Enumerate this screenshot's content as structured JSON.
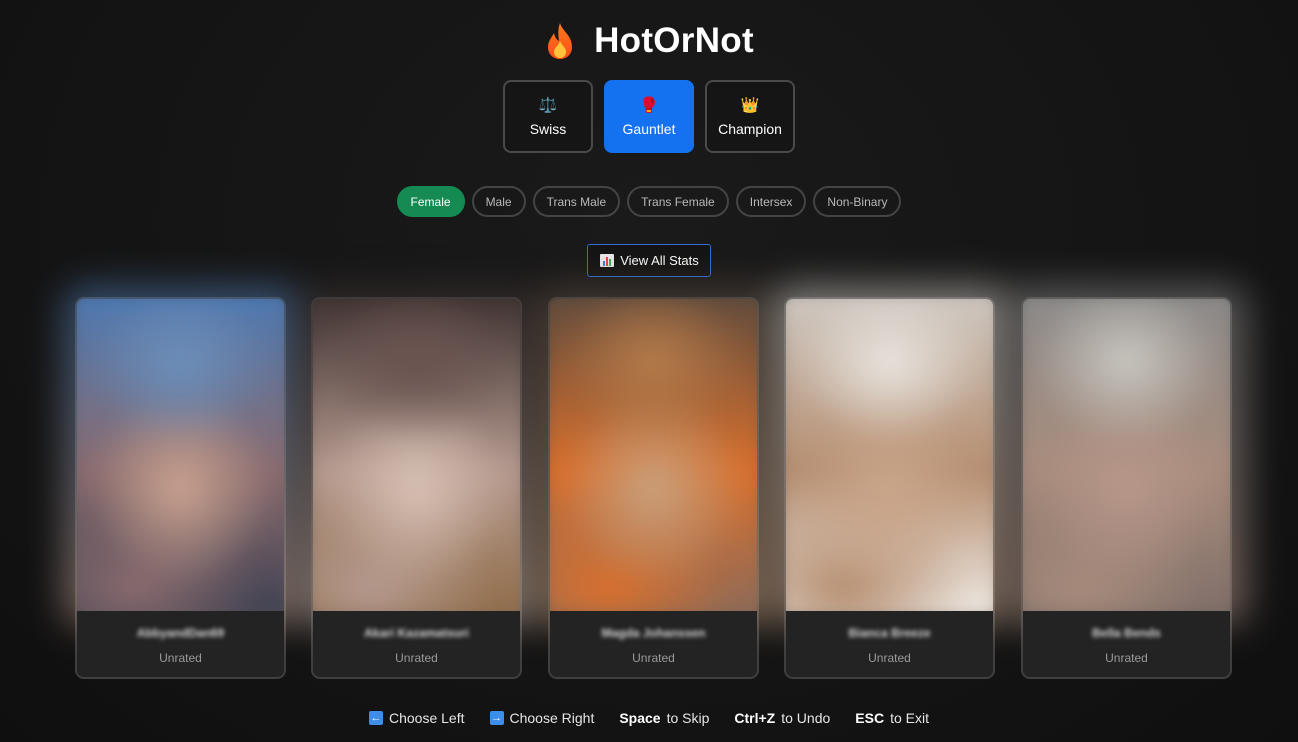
{
  "app": {
    "title": "HotOrNot",
    "logo_icon": "flame-icon"
  },
  "modes": [
    {
      "label": "Swiss",
      "icon": "⚖️",
      "icon_name": "scales-icon",
      "active": false
    },
    {
      "label": "Gauntlet",
      "icon": "🥊",
      "icon_name": "boxing-glove-icon",
      "active": true
    },
    {
      "label": "Champion",
      "icon": "👑",
      "icon_name": "crown-icon",
      "active": false
    }
  ],
  "genders": [
    {
      "label": "Female",
      "active": true
    },
    {
      "label": "Male",
      "active": false
    },
    {
      "label": "Trans Male",
      "active": false
    },
    {
      "label": "Trans Female",
      "active": false
    },
    {
      "label": "Intersex",
      "active": false
    },
    {
      "label": "Non-Binary",
      "active": false
    }
  ],
  "stats_button": {
    "label": "View All Stats",
    "icon": "bar-chart-icon"
  },
  "cards": [
    {
      "name": "AbbyandDan69",
      "rating": "Unrated",
      "tones": [
        "#4a79b4",
        "#6c8fba",
        "#8a6b6e",
        "#c9a28f",
        "#3b3f50"
      ]
    },
    {
      "name": "Akari Kazamatsuri",
      "rating": "Unrated",
      "tones": [
        "#3a2e2e",
        "#6b5450",
        "#b59a8f",
        "#d7c0b4",
        "#8e6a45"
      ]
    },
    {
      "name": "Magda Johanssen",
      "rating": "Unrated",
      "tones": [
        "#5c4a3d",
        "#b47b4a",
        "#d9702d",
        "#c9a07c",
        "#8a6a5a"
      ]
    },
    {
      "name": "Bianca Breeze",
      "rating": "Unrated",
      "tones": [
        "#cfcac4",
        "#e8e4de",
        "#b58d6f",
        "#c9a58a",
        "#f0ede8"
      ]
    },
    {
      "name": "Bella Bends",
      "rating": "Unrated",
      "tones": [
        "#8a8a8a",
        "#c9c6c0",
        "#a88c7c",
        "#b7978a",
        "#7d6d68"
      ]
    }
  ],
  "colors": {
    "accent_blue": "#1472f0",
    "accent_green": "#158a52",
    "background": "#151515"
  },
  "footer": {
    "left_label": "Choose Left",
    "right_label": "Choose Right",
    "skip_key": "Space",
    "skip_label": "to Skip",
    "undo_key": "Ctrl+Z",
    "undo_label": "to Undo",
    "exit_key": "ESC",
    "exit_label": "to Exit"
  }
}
